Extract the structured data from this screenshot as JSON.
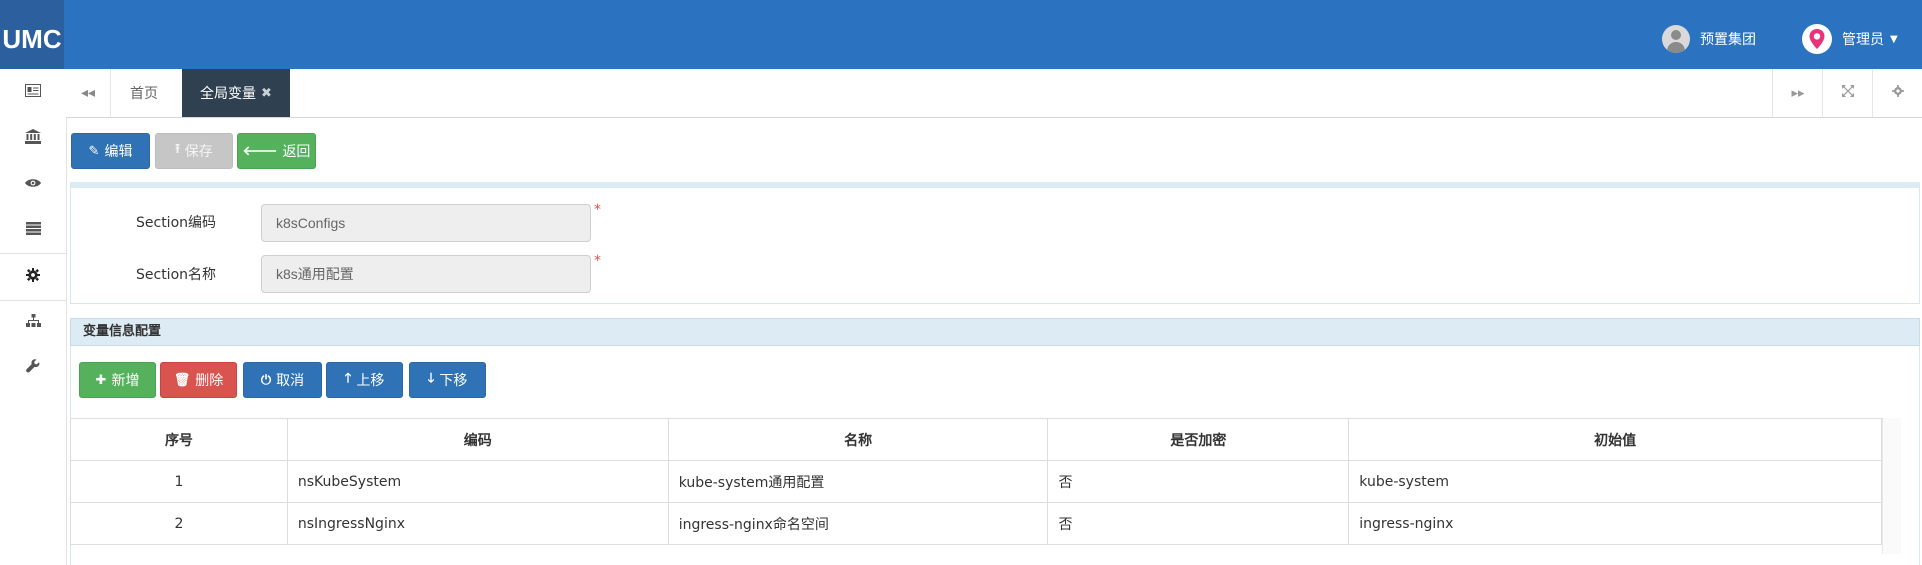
{
  "app": {
    "logo": "UMC"
  },
  "topbar": {
    "org_label": "预置集团",
    "user_label": "管理员"
  },
  "sidebar": {
    "items": [
      {
        "icon": "id-card-icon"
      },
      {
        "icon": "bank-icon"
      },
      {
        "icon": "eye-icon"
      },
      {
        "icon": "list-icon"
      },
      {
        "icon": "gear-icon",
        "active": true
      },
      {
        "icon": "sitemap-icon"
      },
      {
        "icon": "wrench-icon"
      }
    ]
  },
  "tabs": {
    "home": "首页",
    "active": "全局变量"
  },
  "toolbar": {
    "edit": "编辑",
    "save": "保存",
    "back": "返回"
  },
  "form": {
    "code_label": "Section编码",
    "code_value": "k8sConfigs",
    "name_label": "Section名称",
    "name_value": "k8s通用配置",
    "required_mark": "*"
  },
  "variables": {
    "title": "变量信息配置",
    "buttons": {
      "add": "新增",
      "delete": "删除",
      "cancel": "取消",
      "up": "上移",
      "down": "下移"
    },
    "columns": [
      "序号",
      "编码",
      "名称",
      "是否加密",
      "初始值"
    ],
    "rows": [
      [
        "1",
        "nsKubeSystem",
        "kube-system通用配置",
        "否",
        "kube-system"
      ],
      [
        "2",
        "nsIngressNginx",
        "ingress-nginx命名空间",
        "否",
        "ingress-nginx"
      ]
    ]
  },
  "colors": {
    "topbar": "#2b73c0",
    "primary": "#2f73b6",
    "success": "#56b15c",
    "danger": "#d9534f",
    "tab_active": "#2f4050"
  }
}
